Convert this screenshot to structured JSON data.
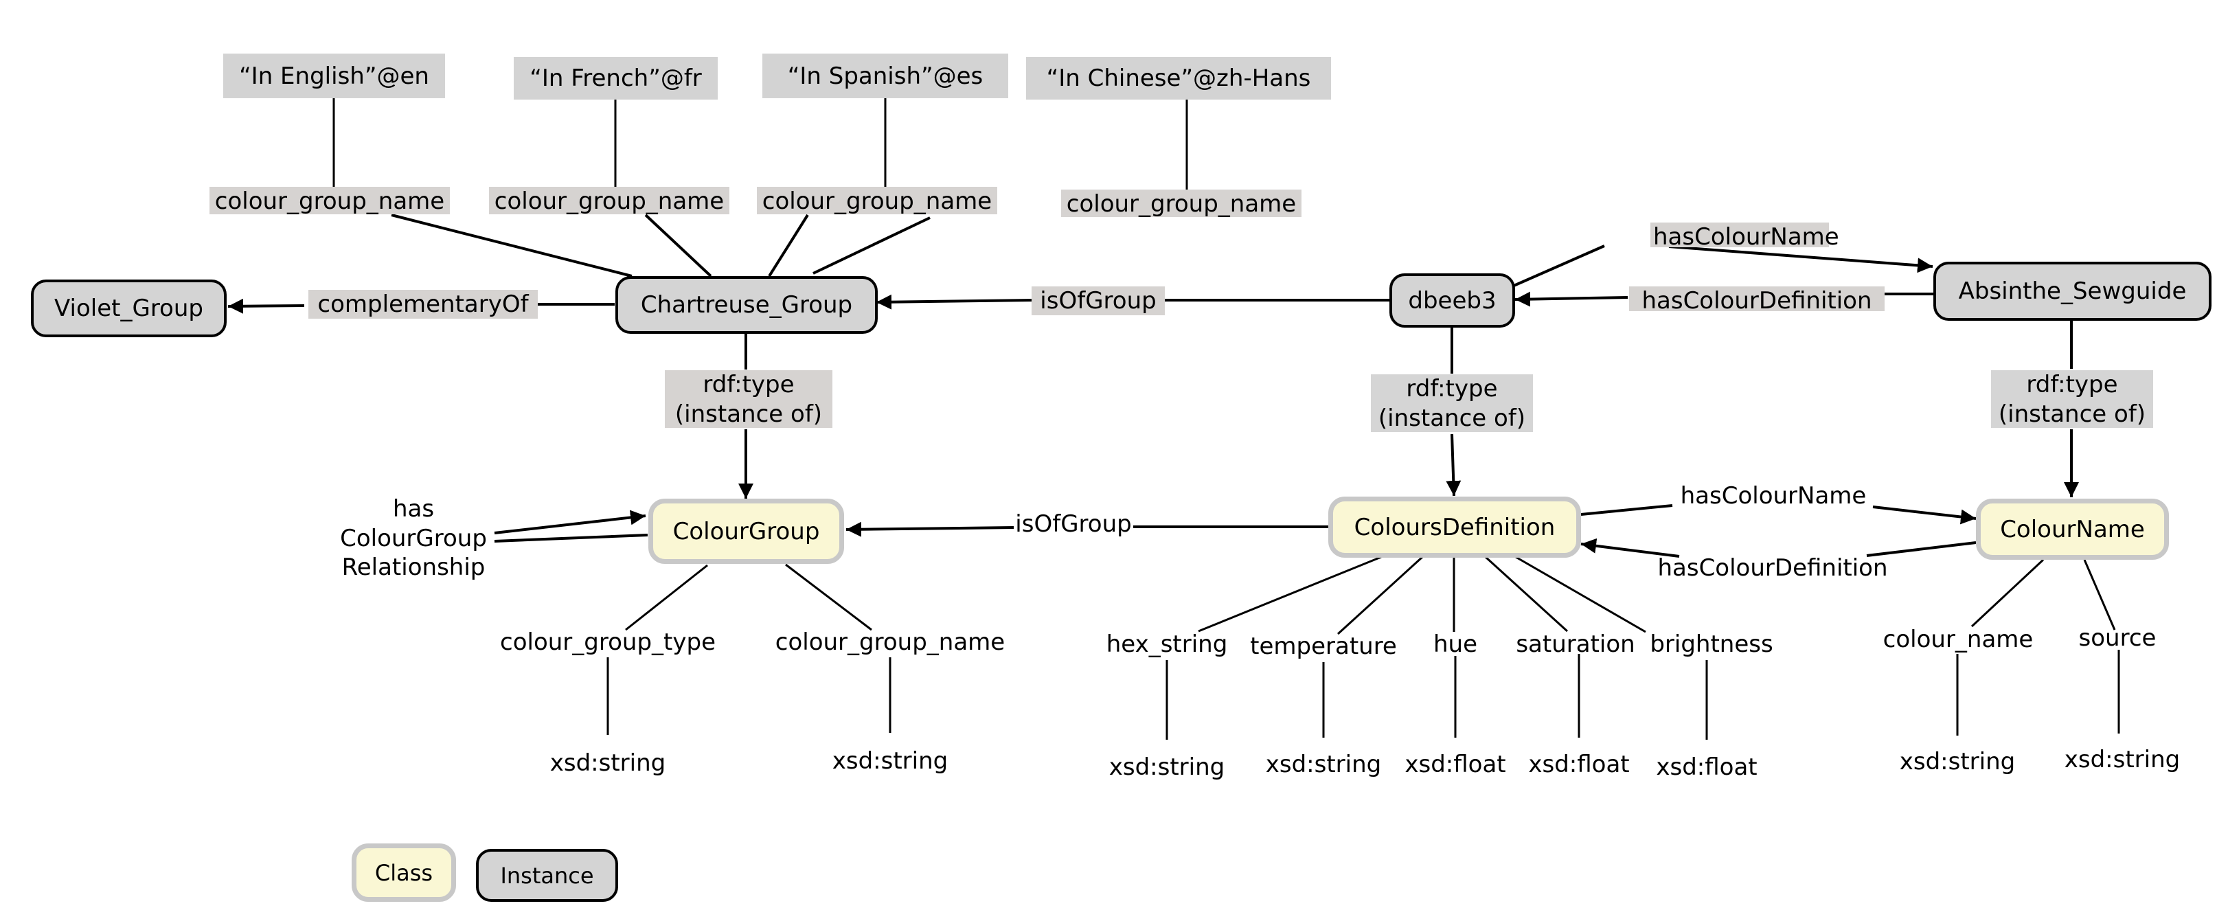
{
  "diagram": {
    "literals": [
      {
        "id": "lit-en",
        "text": "“In English”@en"
      },
      {
        "id": "lit-fr",
        "text": "“In French”@fr"
      },
      {
        "id": "lit-es",
        "text": "“In Spanish”@es"
      },
      {
        "id": "lit-zh",
        "text": "“In Chinese”@zh-Hans"
      }
    ],
    "instances": {
      "violet_group": "Violet_Group",
      "chartreuse_group": "Chartreuse_Group",
      "dbeeb3": "dbeeb3",
      "absinthe_sewguide": "Absinthe_Sewguide"
    },
    "classes": {
      "colour_group": "ColourGroup",
      "colours_definition": "ColoursDefinition",
      "colour_name": "ColourName"
    },
    "edge_labels": {
      "colour_group_name_en": "colour_group_name",
      "colour_group_name_fr": "colour_group_name",
      "colour_group_name_es": "colour_group_name",
      "colour_group_name_zh": "colour_group_name",
      "complementary_of": "complementaryOf",
      "is_of_group_instance": "isOfGroup",
      "has_colour_name_instance": "hasColourName",
      "has_colour_definition_instance": "hasColourDefinition",
      "rdf_type_line1": "rdf:type",
      "rdf_type_line2": "(instance of)",
      "has_colour_group_relationship": [
        "has",
        "ColourGroup",
        "Relationship"
      ],
      "is_of_group_class": "isOfGroup",
      "has_colour_name_class": "hasColourName",
      "has_colour_definition_class": "hasColourDefinition"
    },
    "properties": {
      "colour_group": [
        {
          "name": "colour_group_type",
          "datatype": "xsd:string"
        },
        {
          "name": "colour_group_name",
          "datatype": "xsd:string"
        }
      ],
      "colours_definition": [
        {
          "name": "hex_string",
          "datatype": "xsd:string"
        },
        {
          "name": "temperature",
          "datatype": "xsd:string"
        },
        {
          "name": "hue",
          "datatype": "xsd:float"
        },
        {
          "name": "saturation",
          "datatype": "xsd:float"
        },
        {
          "name": "brightness",
          "datatype": "xsd:float"
        }
      ],
      "colour_name": [
        {
          "name": "colour_name",
          "datatype": "xsd:string"
        },
        {
          "name": "source",
          "datatype": "xsd:string"
        }
      ]
    },
    "legend": {
      "class_label": "Class",
      "instance_label": "Instance"
    },
    "colors": {
      "class_fill": "#faf7d4",
      "class_border": "#c8c8c8",
      "instance_fill": "#d4d4d4",
      "instance_border": "#000000",
      "label_bg": "#d6d3d1"
    }
  }
}
